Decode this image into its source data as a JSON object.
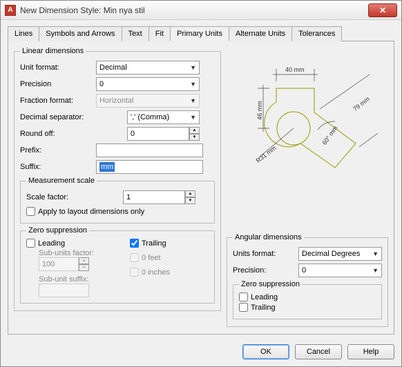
{
  "window": {
    "title": "New Dimension Style: Min nya stil"
  },
  "tabs": [
    "Lines",
    "Symbols and Arrows",
    "Text",
    "Fit",
    "Primary Units",
    "Alternate Units",
    "Tolerances"
  ],
  "active_tab": "Primary Units",
  "linear": {
    "legend": "Linear dimensions",
    "unit_format_label": "Unit format:",
    "unit_format": "Decimal",
    "precision_label": "Precision",
    "precision": "0",
    "fraction_format_label": "Fraction format:",
    "fraction_format": "Horizontal",
    "decimal_sep_label": "Decimal separator:",
    "decimal_sep": "',' (Comma)",
    "round_off_label": "Round off:",
    "round_off": "0",
    "prefix_label": "Prefix:",
    "prefix": "",
    "suffix_label": "Suffix:",
    "suffix": "mm"
  },
  "scale": {
    "legend": "Measurement scale",
    "scale_factor_label": "Scale factor:",
    "scale_factor": "1",
    "apply_label": "Apply to layout dimensions only",
    "apply_checked": false
  },
  "zs": {
    "legend": "Zero suppression",
    "leading_label": "Leading",
    "leading_checked": false,
    "trailing_label": "Trailing",
    "trailing_checked": true,
    "sub_factor_label": "Sub-units factor:",
    "sub_factor": "100",
    "sub_suffix_label": "Sub-unit suffix:",
    "sub_suffix": "",
    "feet_label": "0 feet",
    "inches_label": "0 inches"
  },
  "angular": {
    "legend": "Angular dimensions",
    "units_label": "Units format:",
    "units": "Decimal Degrees",
    "precision_label": "Precision:",
    "precision": "0",
    "zs_legend": "Zero suppression",
    "leading_label": "Leading",
    "trailing_label": "Trailing"
  },
  "preview": {
    "d1": "40  mm",
    "d2": "46  mm",
    "d3": "79  mm",
    "d4": "60°  mm",
    "d5": "R31  mm"
  },
  "buttons": {
    "ok": "OK",
    "cancel": "Cancel",
    "help": "Help"
  }
}
